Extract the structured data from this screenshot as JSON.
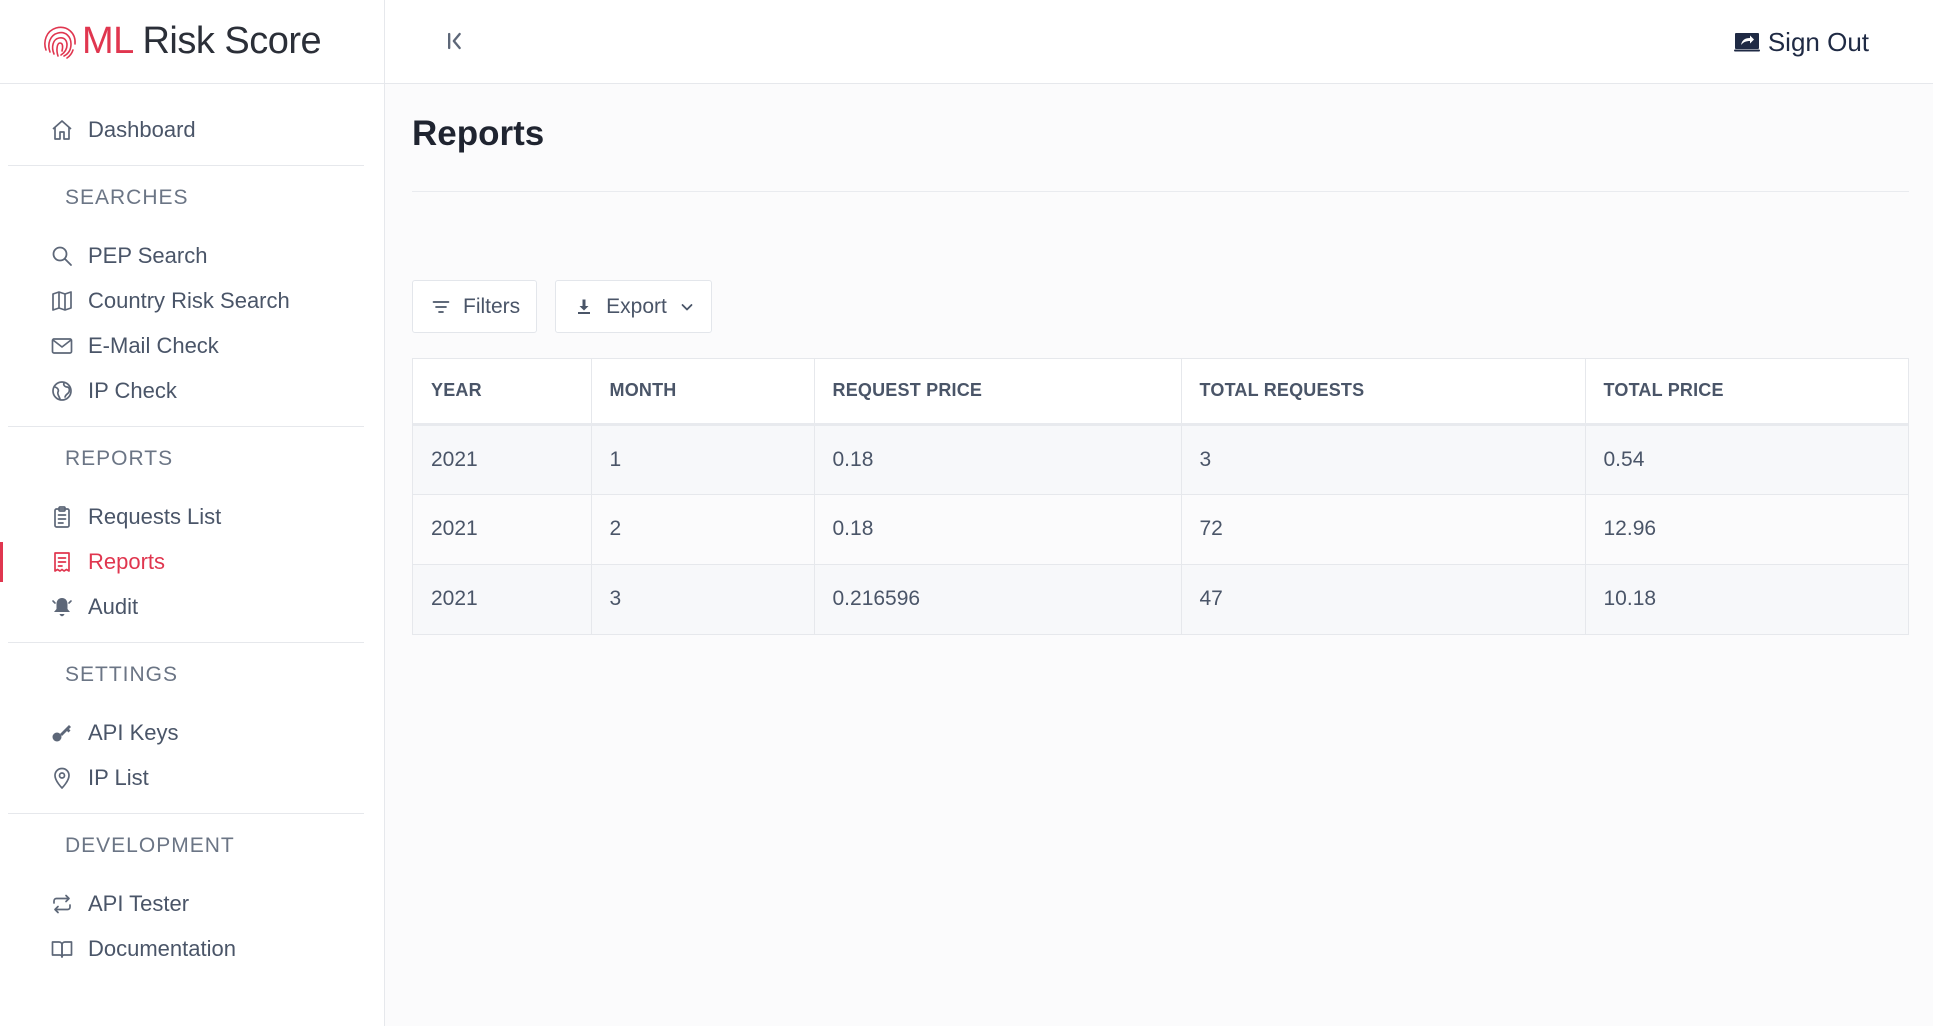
{
  "brand": {
    "accent": "ML",
    "rest": " Risk Score",
    "accent_color": "#e0364f"
  },
  "topbar": {
    "signout_label": "Sign Out"
  },
  "nav": {
    "dashboard": "Dashboard",
    "sections": [
      {
        "title": "SEARCHES",
        "items": [
          "PEP Search",
          "Country Risk Search",
          "E-Mail Check",
          "IP Check"
        ]
      },
      {
        "title": "REPORTS",
        "items": [
          "Requests List",
          "Reports",
          "Audit"
        ]
      },
      {
        "title": "SETTINGS",
        "items": [
          "API Keys",
          "IP List"
        ]
      },
      {
        "title": "DEVELOPMENT",
        "items": [
          "API Tester",
          "Documentation"
        ]
      }
    ],
    "active": "Reports"
  },
  "page": {
    "title": "Reports"
  },
  "toolbar": {
    "filters_label": "Filters",
    "export_label": "Export"
  },
  "table": {
    "columns": [
      "YEAR",
      "MONTH",
      "REQUEST PRICE",
      "TOTAL REQUESTS",
      "TOTAL PRICE"
    ],
    "rows": [
      [
        "2021",
        "1",
        "0.18",
        "3",
        "0.54"
      ],
      [
        "2021",
        "2",
        "0.18",
        "72",
        "12.96"
      ],
      [
        "2021",
        "3",
        "0.216596",
        "47",
        "10.18"
      ]
    ]
  }
}
